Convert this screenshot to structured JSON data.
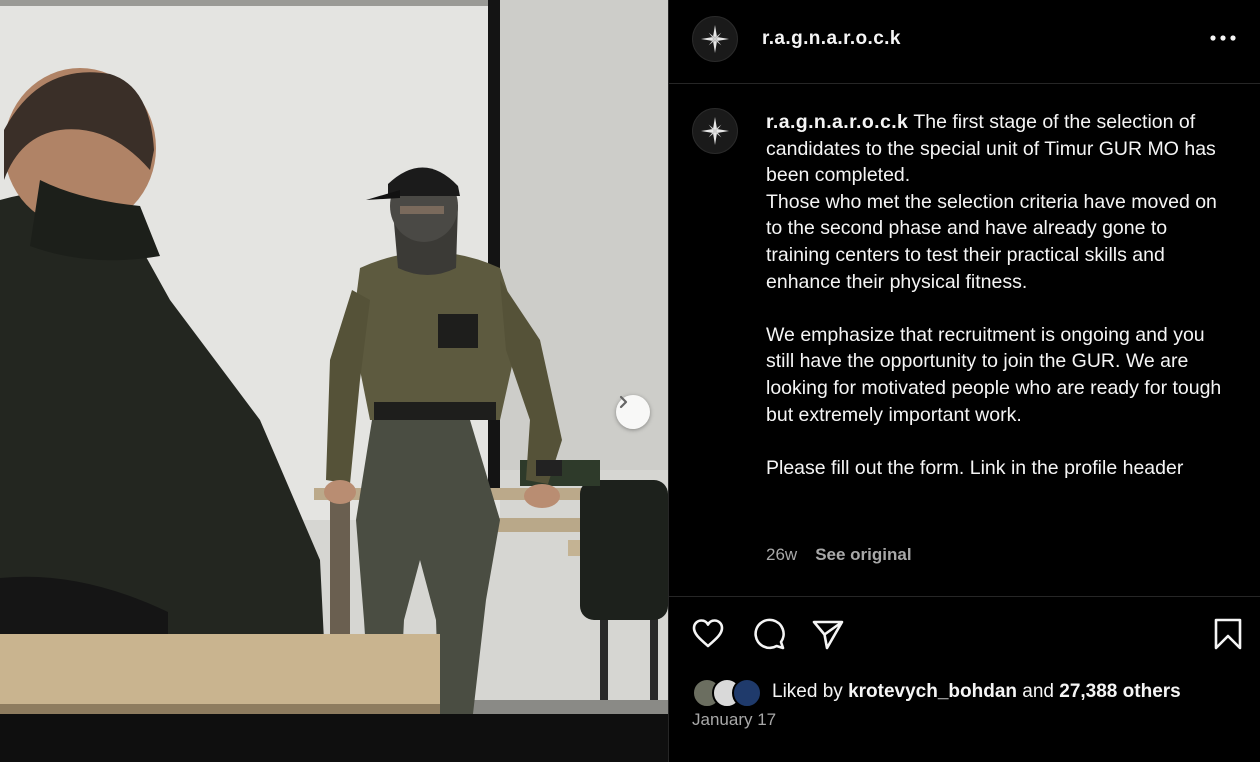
{
  "post": {
    "username": "r.a.g.n.a.r.o.c.k",
    "caption_lines": [
      "The first stage of the selection of candidates to the special unit of Timur GUR MO has been completed.",
      "Those who met the selection criteria have moved on to the second phase and have already gone to training centers to test their practical skills and enhance their physical fitness.",
      "We emphasize that recruitment is ongoing and you still have the opportunity to join the GUR. We are looking for motivated people who are ready for tough but extremely important work.",
      "Please fill out the form. Link in the profile header"
    ],
    "age": "26w",
    "see_original": "See original",
    "likes": {
      "prefix": "Liked by",
      "user": "krotevych_bohdan",
      "joiner": "and",
      "others": "27,388 others"
    },
    "date": "January 17"
  },
  "icons": {
    "avatar": "compass-star-icon",
    "more": "more-options-icon",
    "like": "heart-icon",
    "comment": "comment-icon",
    "share": "paper-plane-icon",
    "save": "bookmark-icon",
    "next": "chevron-right-icon"
  },
  "colors": {
    "background": "#000000",
    "text": "#f5f5f5",
    "muted": "#a8a8a8",
    "divider": "#262626"
  }
}
